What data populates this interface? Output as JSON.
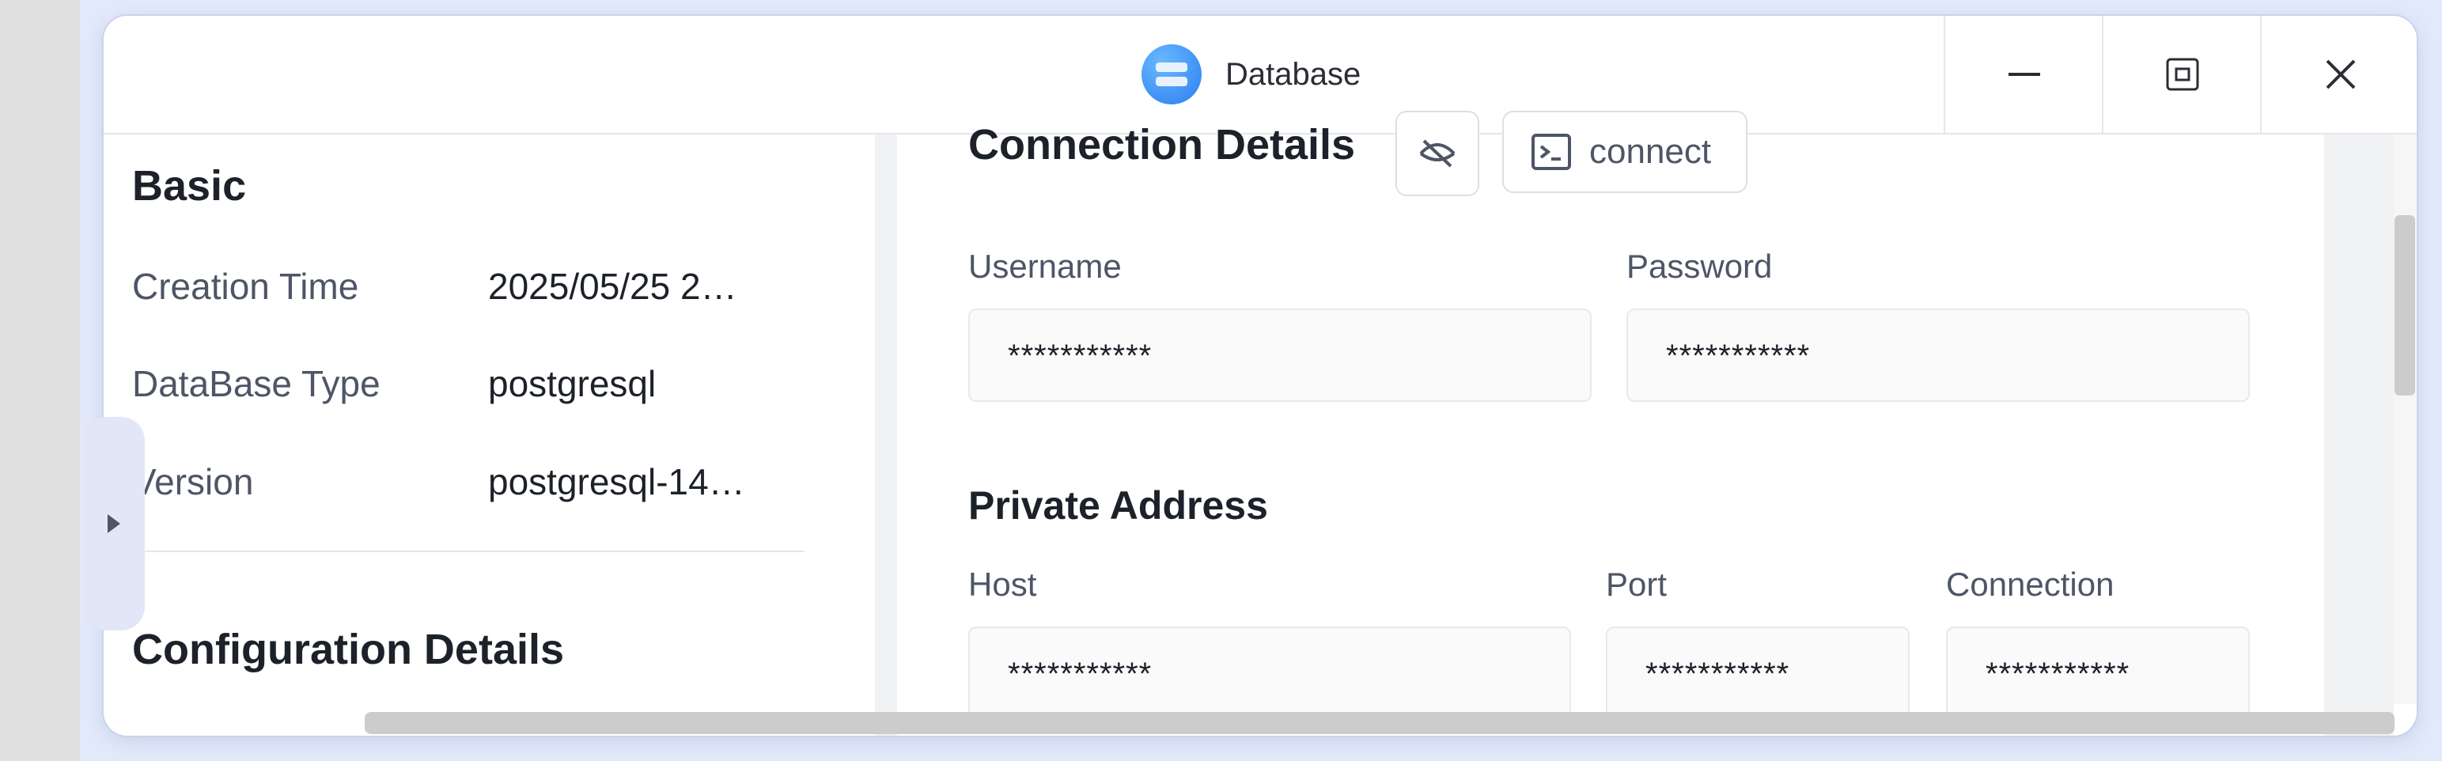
{
  "window": {
    "title": "Database",
    "app_icon": "database-icon"
  },
  "title_controls": {
    "minimize_icon": "minimize-icon",
    "restore_icon": "restore-icon",
    "close_icon": "close-icon"
  },
  "sidebar": {
    "heading": "Basic",
    "fields": [
      {
        "label": "Creation Time",
        "value": "2025/05/25 2…"
      },
      {
        "label": "DataBase Type",
        "value": "postgresql"
      },
      {
        "label": "Version",
        "value": "postgresql-14…"
      }
    ],
    "section2_heading": "Configuration Details",
    "collapse_icon": "caret-right-icon"
  },
  "connection": {
    "heading": "Connection Details",
    "toggle_visibility_icon": "eye-off-icon",
    "connect_label": "connect",
    "connect_icon": "terminal-icon",
    "username": {
      "label": "Username",
      "value": "***********"
    },
    "password": {
      "label": "Password",
      "value": "***********"
    },
    "private_address": {
      "heading": "Private Address",
      "host": {
        "label": "Host",
        "value": "***********"
      },
      "port": {
        "label": "Port",
        "value": "***********"
      },
      "connection": {
        "label": "Connection",
        "value": "***********"
      }
    }
  },
  "colors": {
    "accent": "#2a7ef0",
    "window_bg": "#ffffff",
    "desktop_bg": "#e2e9fa",
    "text": "#1d2129",
    "muted_text": "#4e5566"
  }
}
